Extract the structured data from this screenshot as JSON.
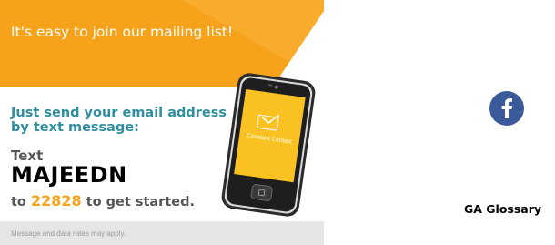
{
  "promo": {
    "banner_text": "It's easy to join our mailing list!",
    "instruction": "Just send your email address by text message:",
    "text_label": "Text",
    "keyword": "MAJEEDN",
    "to_word": "to",
    "shortcode": "22828",
    "get_started": "to get started.",
    "disclaimer": "Message and data rates may apply.",
    "phone_screen_logo": "Constant Contact",
    "colors": {
      "banner": "#f7a21b",
      "banner_dark": "#e89210",
      "accent_teal": "#2f8fa0",
      "shortcode_orange": "#f7a21b"
    }
  },
  "social": {
    "facebook_icon": "facebook-icon",
    "facebook_color": "#3b5a9a"
  },
  "glossary_link": "GA Glossary"
}
